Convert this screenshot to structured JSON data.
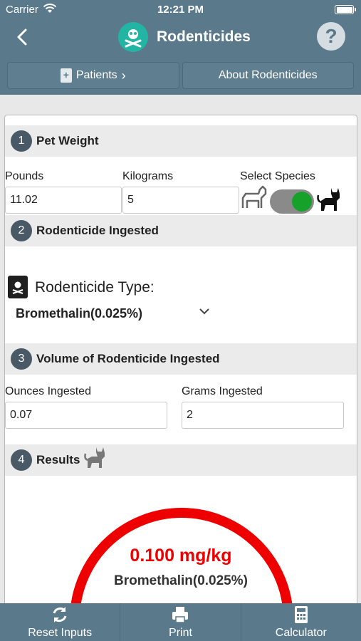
{
  "status_bar": {
    "carrier": "Carrier",
    "time": "12:21 PM"
  },
  "nav": {
    "title": "Rodenticides",
    "help_symbol": "?"
  },
  "segments": {
    "patients": "Patients",
    "about": "About Rodenticides"
  },
  "sections": {
    "pet_weight": {
      "number": "1",
      "title": "Pet Weight"
    },
    "rodenticide_ingested": {
      "number": "2",
      "title": "Rodenticide Ingested"
    },
    "volume_ingested": {
      "number": "3",
      "title": "Volume of Rodenticide Ingested"
    },
    "results": {
      "number": "4",
      "title": "Results"
    }
  },
  "pet_weight": {
    "pounds_label": "Pounds",
    "pounds_value": "11.02",
    "kilograms_label": "Kilograms",
    "kilograms_value": "5",
    "species_label": "Select Species",
    "species_selected": "cat"
  },
  "rodenticide": {
    "type_label": "Rodenticide Type:",
    "selected": "Bromethalin(0.025%)"
  },
  "volume": {
    "ounces_label": "Ounces Ingested",
    "ounces_value": "0.07",
    "grams_label": "Grams Ingested",
    "grams_value": "2"
  },
  "results": {
    "value": "0.100 mg/kg",
    "product": "Bromethalin(0.025%)"
  },
  "tabbar": {
    "reset": "Reset Inputs",
    "print": "Print",
    "calculator": "Calculator"
  },
  "colors": {
    "header": "#5a7a8c",
    "accent_teal": "#22b5a4",
    "toggle_on": "#16a22a",
    "result_red": "#ee0000"
  }
}
